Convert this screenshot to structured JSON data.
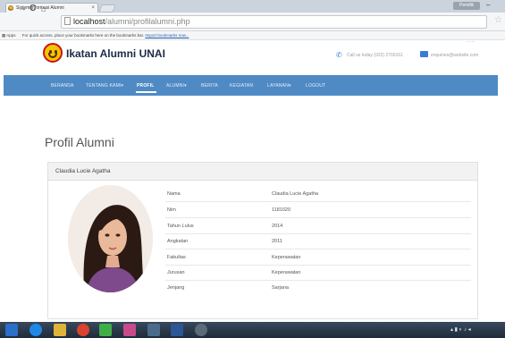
{
  "browser": {
    "tab_title": "Sistem Informasi Alumni",
    "url_host": "localhost",
    "url_path": "/alumni/profilalumni.php",
    "bookmarks_apps": "Apps",
    "bookmarks_hint": "For quick access, place your bookmarks here on the bookmarks bar.",
    "bookmarks_import": "Import bookmarks now...",
    "user_button": "Pemilik"
  },
  "site": {
    "brand": "Ikatan Alumni UNAI",
    "phone": "Call us today (022) 2700161",
    "email": "enquiries@website.com",
    "nav": [
      "BERANDA",
      "TENTANG KAMI",
      "PROFIL",
      "ALUMNI",
      "BERITA",
      "KEGIATAN",
      "LAYANAN",
      "LOGOUT"
    ],
    "nav_active": "PROFIL"
  },
  "profile": {
    "page_title": "Profil Alumni",
    "name": "Claudia Lucie Agatha",
    "fields": [
      {
        "label": "Nama",
        "value": "Claudia Lucie Agatha"
      },
      {
        "label": "Nim",
        "value": "1181020"
      },
      {
        "label": "Tahun Lulus",
        "value": "2014"
      },
      {
        "label": "Angkatan",
        "value": "2011"
      },
      {
        "label": "Fakultas",
        "value": "Keperawatan"
      },
      {
        "label": "Jurusan",
        "value": "Keperawatan"
      },
      {
        "label": "Jenjang",
        "value": "Sarjana"
      }
    ]
  },
  "icons": {
    "phone": "phone-icon",
    "email": "envelope-icon",
    "favicon": "site-favicon-icon"
  }
}
